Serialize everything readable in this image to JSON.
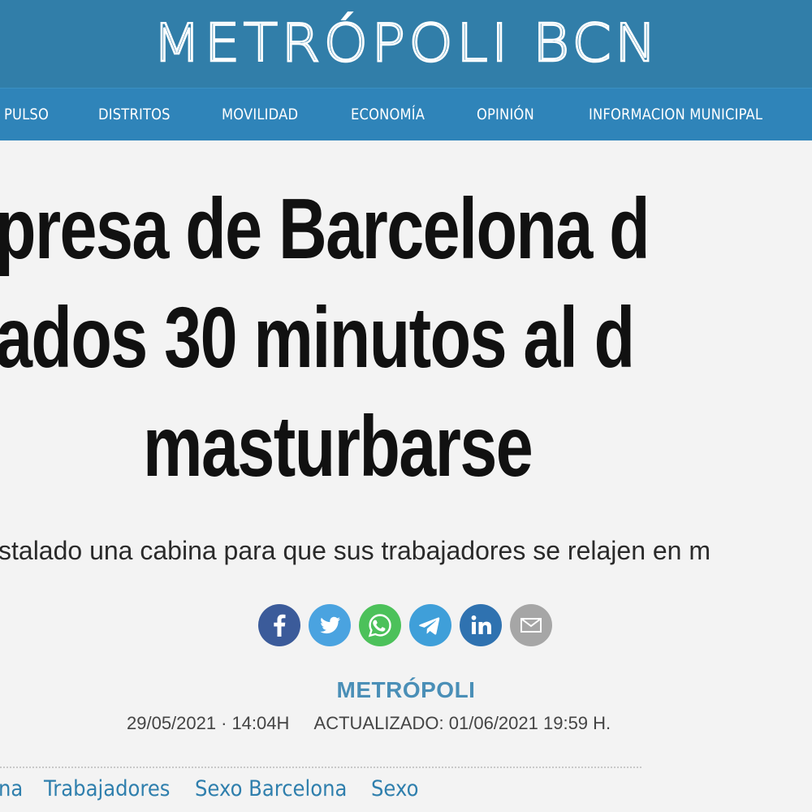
{
  "site": {
    "logo_text": "METRÓPOLI BCN",
    "header_color": "#317ea9",
    "nav_color": "#2f84b9"
  },
  "nav": {
    "items": [
      {
        "label": "PULSO"
      },
      {
        "label": "DISTRITOS"
      },
      {
        "label": "MOVILIDAD"
      },
      {
        "label": "ECONOMÍA"
      },
      {
        "label": "OPINIÓN"
      },
      {
        "label": "INFORMACION MUNICIPAL"
      }
    ]
  },
  "article": {
    "headline_lines": [
      "presa de Barcelona d",
      "ados 30 minutos al d",
      "masturbarse"
    ],
    "subtitle": "stalado una cabina para que sus trabajadores se relajen en m",
    "author": "METRÓPOLI",
    "published": "29/05/2021",
    "published_time": "14:04H",
    "separator": "·",
    "updated": "ACTUALIZADO: 01/06/2021 19:59 H."
  },
  "share": {
    "buttons": [
      {
        "name": "facebook",
        "icon": "facebook-icon",
        "color": "#3b5b9a"
      },
      {
        "name": "twitter",
        "icon": "twitter-icon",
        "color": "#4aa3e0"
      },
      {
        "name": "whatsapp",
        "icon": "whatsapp-icon",
        "color": "#4cc15a"
      },
      {
        "name": "telegram",
        "icon": "telegram-icon",
        "color": "#3f9fd9"
      },
      {
        "name": "linkedin",
        "icon": "linkedin-icon",
        "color": "#2f72b0"
      },
      {
        "name": "email",
        "icon": "mail-icon",
        "color": "#a6a6a6"
      }
    ]
  },
  "tags": [
    {
      "label": "na"
    },
    {
      "label": "Trabajadores"
    },
    {
      "label": "Sexo Barcelona"
    },
    {
      "label": "Sexo"
    }
  ],
  "colors": {
    "link": "#2f7fad",
    "author": "#4a8fb7",
    "headline": "#111111"
  }
}
